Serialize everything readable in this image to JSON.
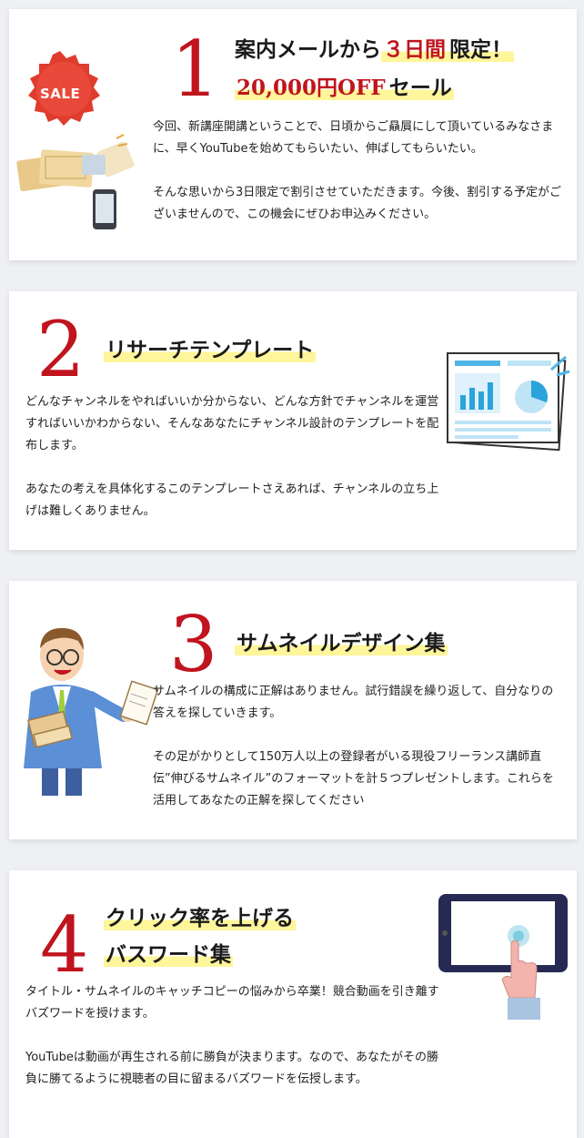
{
  "sections": [
    {
      "number": "1",
      "title_line1_pre": "案内メールから",
      "title_line1_highlight": "３日間",
      "title_line1_post": "限定！",
      "title_line2_highlight": "20,000円OFF",
      "title_line2_post": "セール",
      "badge": "SALE",
      "paragraphs": [
        "今回、新講座開講ということで、日頃からご贔屓にして頂いているみなさまに、早くYouTubeを始めてもらいたい、伸ばしてもらいたい。",
        "そんな思いから3日限定で割引させていただきます。今後、割引する予定がございませんので、この機会にぜひお申込みください。"
      ]
    },
    {
      "number": "2",
      "title": "リサーチテンプレート",
      "paragraphs": [
        "どんなチャンネルをやればいいか分からない、どんな方針でチャンネルを運営すればいいかわからない、そんなあなたにチャンネル設計のテンプレートを配布します。",
        "あなたの考えを具体化するこのテンプレートさえあれば、チャンネルの立ち上げは難しくありません。"
      ]
    },
    {
      "number": "3",
      "title": "サムネイルデザイン集",
      "paragraphs": [
        "サムネイルの構成に正解はありません。試行錯誤を繰り返して、自分なりの答えを探していきます。",
        "その足がかりとして150万人以上の登録者がいる現役フリーランス講師直伝”伸びるサムネイル”のフォーマットを計５つプレゼントします。これらを活用してあなたの正解を探してください"
      ]
    },
    {
      "number": "4",
      "title_line1": "クリック率を上げる",
      "title_line2": "バスワード集",
      "paragraphs": [
        "タイトル・サムネイルのキャッチコピーの悩みから卒業！競合動画を引き離すバズワードを授けます。",
        "YouTubeは動画が再生される前に勝負が決まります。なので、あなたがその勝負に勝てるように視聴者の目に留まるバズワードを伝授します。"
      ]
    }
  ],
  "colors": {
    "accent": "#c0141e",
    "highlight": "#fff59a",
    "background": "#eef0f4"
  }
}
